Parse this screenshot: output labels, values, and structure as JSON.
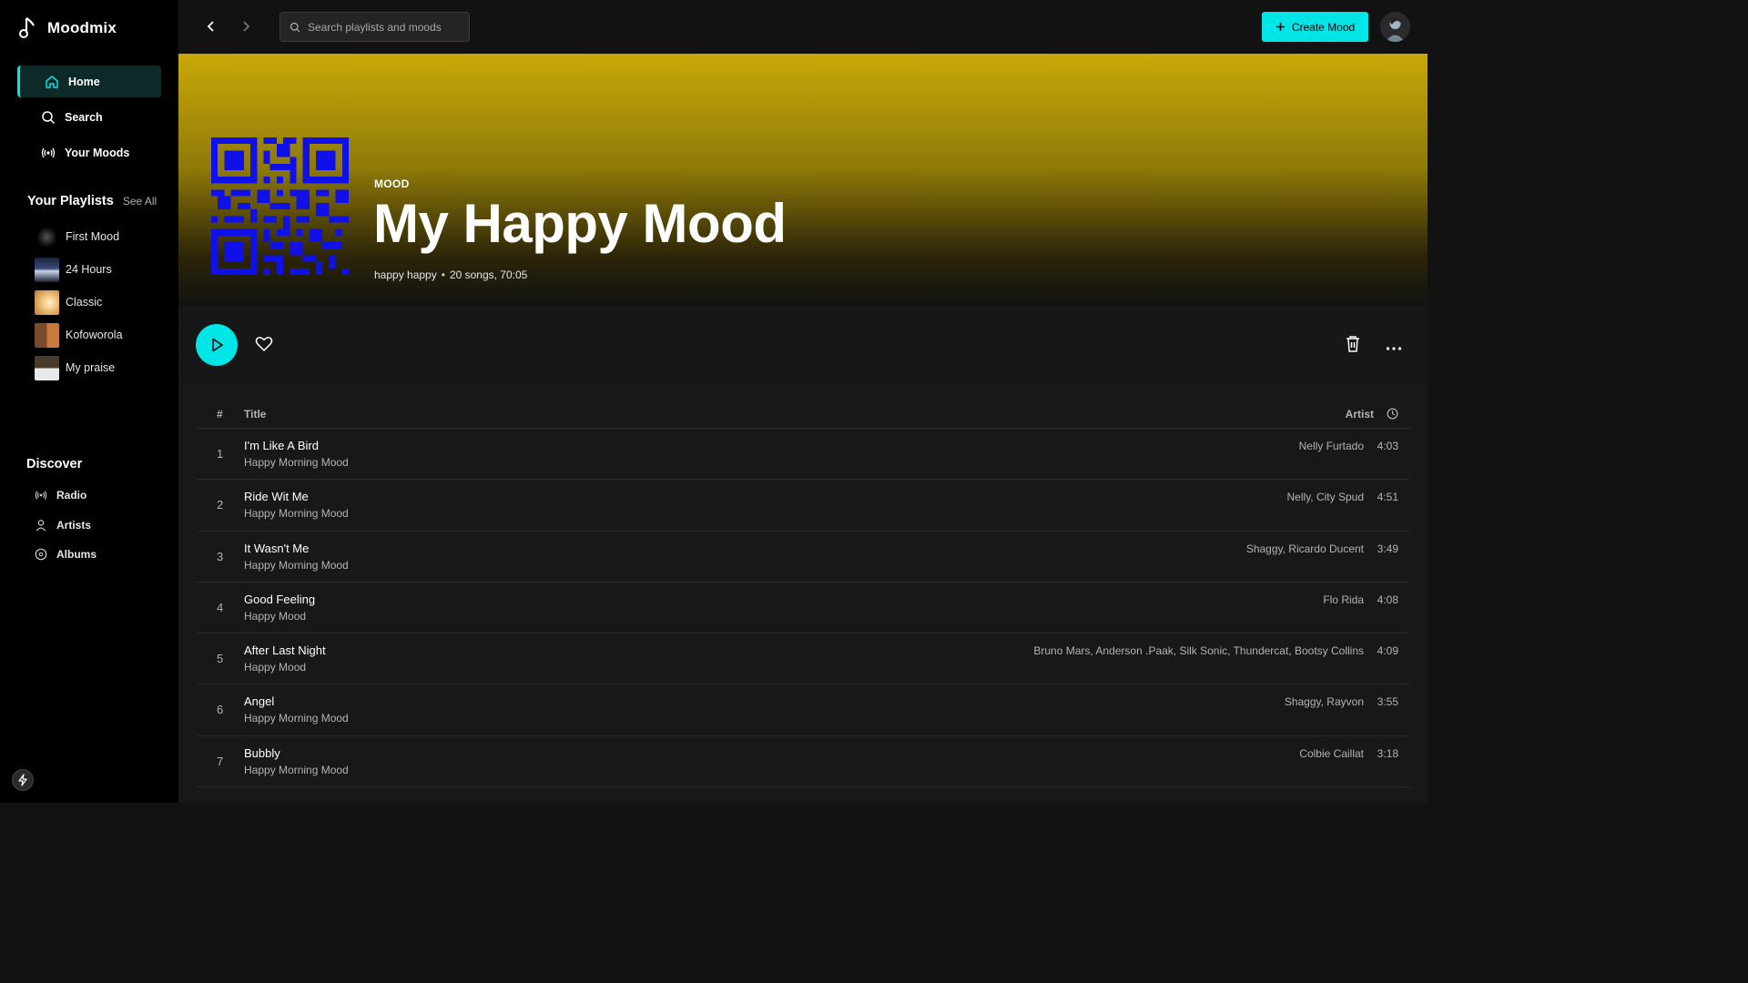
{
  "app": {
    "name": "Moodmix"
  },
  "sidebar": {
    "nav": [
      {
        "label": "Home",
        "icon": "home-icon",
        "active": true
      },
      {
        "label": "Search",
        "icon": "search-icon",
        "active": false
      },
      {
        "label": "Your Moods",
        "icon": "broadcast-icon",
        "active": false
      }
    ],
    "playlists_title": "Your Playlists",
    "see_all": "See All",
    "playlists": [
      {
        "label": "First Mood"
      },
      {
        "label": "24 Hours"
      },
      {
        "label": "Classic"
      },
      {
        "label": "Kofoworola"
      },
      {
        "label": "My praise"
      }
    ],
    "discover_title": "Discover",
    "discover": [
      {
        "label": "Radio",
        "icon": "radio-icon"
      },
      {
        "label": "Artists",
        "icon": "user-icon"
      },
      {
        "label": "Albums",
        "icon": "disc-icon"
      }
    ]
  },
  "topbar": {
    "search_placeholder": "Search playlists and moods",
    "create_label": "Create Mood"
  },
  "hero": {
    "label": "MOOD",
    "title": "My Happy Mood",
    "description": "happy happy",
    "stats": "20 songs, 70:05"
  },
  "table": {
    "col_num": "#",
    "col_title": "Title",
    "col_artist": "Artist",
    "rows": [
      {
        "num": "1",
        "title": "I'm Like A Bird",
        "sub": "Happy Morning Mood",
        "artist": "Nelly Furtado",
        "dur": "4:03"
      },
      {
        "num": "2",
        "title": "Ride Wit Me",
        "sub": "Happy Morning Mood",
        "artist": "Nelly, City Spud",
        "dur": "4:51"
      },
      {
        "num": "3",
        "title": "It Wasn't Me",
        "sub": "Happy Morning Mood",
        "artist": "Shaggy, Ricardo Ducent",
        "dur": "3:49"
      },
      {
        "num": "4",
        "title": "Good Feeling",
        "sub": "Happy Mood",
        "artist": "Flo Rida",
        "dur": "4:08"
      },
      {
        "num": "5",
        "title": "After Last Night",
        "sub": "Happy Mood",
        "artist": "Bruno Mars, Anderson .Paak, Silk Sonic, Thundercat, Bootsy Collins",
        "dur": "4:09"
      },
      {
        "num": "6",
        "title": "Angel",
        "sub": "Happy Morning Mood",
        "artist": "Shaggy, Rayvon",
        "dur": "3:55"
      },
      {
        "num": "7",
        "title": "Bubbly",
        "sub": "Happy Morning Mood",
        "artist": "Colbie Caillat",
        "dur": "3:18"
      }
    ]
  },
  "colors": {
    "accent": "#00e5e5",
    "hero_top": "#c8a808",
    "cover_blue": "#1010e8"
  }
}
